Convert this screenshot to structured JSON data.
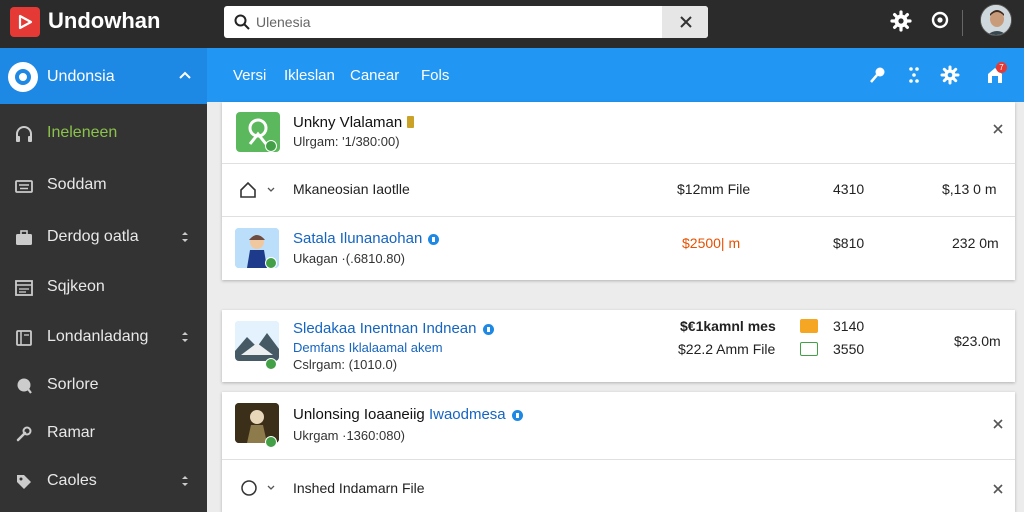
{
  "app": {
    "title": "Undowhan"
  },
  "search": {
    "placeholder": "Ulenesia"
  },
  "topbar": {
    "icons": [
      "gear-icon",
      "eye-icon",
      "avatar"
    ]
  },
  "sidebar": {
    "header": "Undonsia",
    "items": [
      {
        "label": "Ineleneen",
        "icon": "headset-icon",
        "active": true,
        "caret": false
      },
      {
        "label": "Soddam",
        "icon": "keyboard-icon",
        "active": false,
        "caret": false
      },
      {
        "label": "Derdog oatla",
        "icon": "briefcase-icon",
        "active": false,
        "caret": true
      },
      {
        "label": "Sqjkeon",
        "icon": "window-icon",
        "active": false,
        "caret": false
      },
      {
        "label": "Londanladang",
        "icon": "book-icon",
        "active": false,
        "caret": true
      },
      {
        "label": "Sorlore",
        "icon": "search-circle-icon",
        "active": false,
        "caret": false
      },
      {
        "label": "Ramar",
        "icon": "wrench-icon",
        "active": false,
        "caret": false
      },
      {
        "label": "Caoles",
        "icon": "tag-icon",
        "active": false,
        "caret": true
      }
    ]
  },
  "nav": {
    "links": [
      "Versi",
      "Ikleslan",
      "Canear",
      "Fols"
    ],
    "icons": [
      "pin-icon",
      "grid-icon",
      "settings-icon",
      "notifications-icon"
    ],
    "badge": "7"
  },
  "colors": {
    "topbar": "#2b2b2b",
    "accent": "#2196f3",
    "sidebar": "#333333",
    "active": "#8bc34a",
    "price_highlight": "#e65100"
  },
  "card1": {
    "row1": {
      "title": "Unkny Vlalaman",
      "sub": "Ulrgam: '1/380:00)"
    },
    "row2": {
      "title": "Mkaneosian Iaotlle",
      "price": "$12mm File",
      "count": "4310",
      "total": "$,13 0 m"
    },
    "row3": {
      "title": "Satala Ilunanaohan",
      "sub": "Ukagan ·(.6810.80)",
      "price": "$2500| m",
      "count": "$810",
      "total": "232 0m"
    }
  },
  "card2": {
    "title": "Sledakaa Inentnan Indnean",
    "sub1": "Demfans Iklalaamal akem",
    "sub2": "Cslrgam: (1010.0)",
    "line1": "$€1kamnl mes",
    "line2": "$22.2 Amm File",
    "count1": "3140",
    "count2": "3550",
    "total": "$23.0m"
  },
  "card3": {
    "row1": {
      "title": "Unlonsing Ioaaneiig",
      "title_blue": "Iwaodmesa",
      "sub": "Ukrgam ·1360:080)"
    },
    "row2": {
      "title": "Inshed Indamarn File"
    }
  }
}
